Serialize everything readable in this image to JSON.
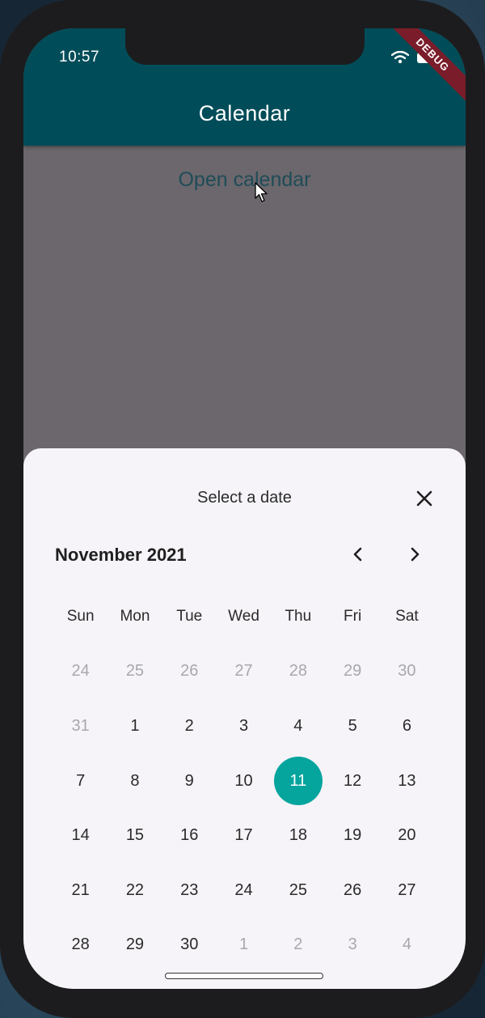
{
  "status_bar": {
    "time": "10:57"
  },
  "debug_banner": "DEBUG",
  "app_bar": {
    "title": "Calendar"
  },
  "main": {
    "open_calendar_label": "Open calendar"
  },
  "date_sheet": {
    "title": "Select a date",
    "month_label": "November 2021",
    "weekdays": [
      "Sun",
      "Mon",
      "Tue",
      "Wed",
      "Thu",
      "Fri",
      "Sat"
    ],
    "weeks": [
      [
        {
          "d": "24",
          "muted": true
        },
        {
          "d": "25",
          "muted": true
        },
        {
          "d": "26",
          "muted": true
        },
        {
          "d": "27",
          "muted": true
        },
        {
          "d": "28",
          "muted": true
        },
        {
          "d": "29",
          "muted": true
        },
        {
          "d": "30",
          "muted": true
        }
      ],
      [
        {
          "d": "31",
          "muted": true
        },
        {
          "d": "1"
        },
        {
          "d": "2"
        },
        {
          "d": "3"
        },
        {
          "d": "4"
        },
        {
          "d": "5"
        },
        {
          "d": "6"
        }
      ],
      [
        {
          "d": "7"
        },
        {
          "d": "8"
        },
        {
          "d": "9"
        },
        {
          "d": "10"
        },
        {
          "d": "11",
          "selected": true
        },
        {
          "d": "12"
        },
        {
          "d": "13"
        }
      ],
      [
        {
          "d": "14"
        },
        {
          "d": "15"
        },
        {
          "d": "16"
        },
        {
          "d": "17"
        },
        {
          "d": "18"
        },
        {
          "d": "19"
        },
        {
          "d": "20"
        }
      ],
      [
        {
          "d": "21"
        },
        {
          "d": "22"
        },
        {
          "d": "23"
        },
        {
          "d": "24"
        },
        {
          "d": "25"
        },
        {
          "d": "26"
        },
        {
          "d": "27"
        }
      ],
      [
        {
          "d": "28"
        },
        {
          "d": "29"
        },
        {
          "d": "30"
        },
        {
          "d": "1",
          "muted": true
        },
        {
          "d": "2",
          "muted": true
        },
        {
          "d": "3",
          "muted": true
        },
        {
          "d": "4",
          "muted": true
        }
      ]
    ]
  },
  "colors": {
    "app_bar": "#004d59",
    "selected_day": "#05a59e",
    "link_text": "#1f4c58",
    "sheet_background": "#f6f4f8"
  },
  "icons": {
    "close": "close-icon",
    "prev_month": "chevron-left-icon",
    "next_month": "chevron-right-icon",
    "wifi": "wifi-icon",
    "battery": "battery-icon",
    "cursor": "mouse-pointer-icon"
  }
}
